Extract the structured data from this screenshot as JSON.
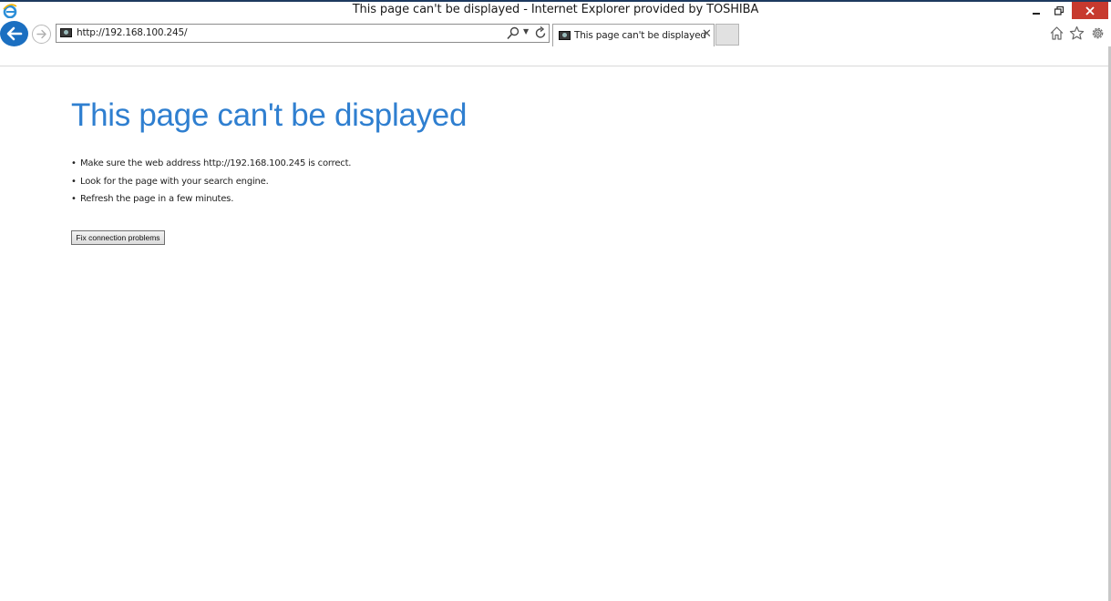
{
  "window": {
    "title": "This page can't be displayed - Internet Explorer provided by TOSHIBA"
  },
  "toolbar": {
    "address": "http://192.168.100.245/",
    "tab_title": "This page can't be displayed",
    "tab_close": "✕",
    "icons": [
      "ie-logo-icon",
      "back-icon",
      "forward-icon",
      "search-icon",
      "dropdown-icon",
      "refresh-icon",
      "home-icon",
      "star-icon",
      "gear-icon",
      "minimize-icon",
      "restore-icon",
      "close-icon"
    ]
  },
  "page": {
    "heading": "This page can't be displayed",
    "tips": [
      "Make sure the web address http://192.168.100.245 is correct.",
      "Look for the page with your search engine.",
      "Refresh the page in a few minutes."
    ],
    "fix_button": "Fix connection problems"
  },
  "colors": {
    "heading": "#2f7fd0",
    "back_button": "#1b6fc1",
    "close_button": "#c73a2e"
  }
}
